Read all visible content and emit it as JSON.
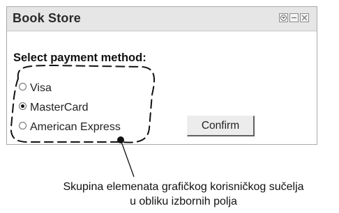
{
  "window": {
    "title": "Book Store",
    "controls": [
      "dropdown-icon",
      "minimize-icon",
      "close-icon"
    ]
  },
  "form": {
    "prompt": "Select payment method:",
    "options": [
      {
        "label": "Visa",
        "selected": false
      },
      {
        "label": "MasterCard",
        "selected": true
      },
      {
        "label": "American Express",
        "selected": false
      }
    ],
    "confirm_label": "Confirm"
  },
  "annotation": {
    "line1": "Skupina elemenata grafičkog korisničkog sučelja",
    "line2": "u obliku izbornih polja"
  }
}
